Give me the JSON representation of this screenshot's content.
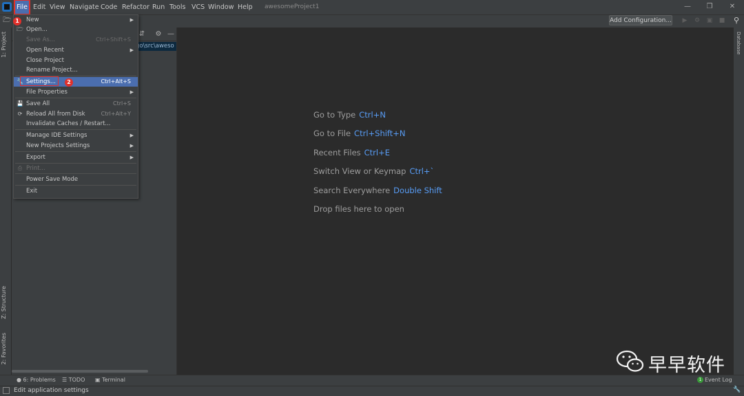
{
  "menubar": {
    "items": [
      "File",
      "Edit",
      "View",
      "Navigate",
      "Code",
      "Refactor",
      "Run",
      "Tools",
      "VCS",
      "Window",
      "Help"
    ],
    "project_title": "awesomeProject1"
  },
  "toolbar": {
    "add_configuration": "Add Configuration..."
  },
  "left_tabs": {
    "project": "1: Project",
    "structure": "Z: Structure",
    "favorites": "2: Favorites"
  },
  "right_tabs": {
    "database": "Database"
  },
  "project_panel": {
    "path_fragment": "go\\src\\aweso"
  },
  "file_menu": {
    "items": [
      {
        "label": "New",
        "shortcut": "",
        "submenu": true,
        "disabled": false
      },
      {
        "label": "Open...",
        "shortcut": "",
        "submenu": false,
        "disabled": false
      },
      {
        "label": "Save As...",
        "shortcut": "Ctrl+Shift+S",
        "submenu": false,
        "disabled": true
      },
      {
        "label": "Open Recent",
        "shortcut": "",
        "submenu": true,
        "disabled": false
      },
      {
        "label": "Close Project",
        "shortcut": "",
        "submenu": false,
        "disabled": false
      },
      {
        "label": "Rename Project...",
        "shortcut": "",
        "submenu": false,
        "disabled": false
      },
      {
        "label": "Settings...",
        "shortcut": "Ctrl+Alt+S",
        "submenu": false,
        "disabled": false,
        "selected": true
      },
      {
        "label": "File Properties",
        "shortcut": "",
        "submenu": true,
        "disabled": false
      },
      {
        "label": "Save All",
        "shortcut": "Ctrl+S",
        "submenu": false,
        "disabled": false
      },
      {
        "label": "Reload All from Disk",
        "shortcut": "Ctrl+Alt+Y",
        "submenu": false,
        "disabled": false
      },
      {
        "label": "Invalidate Caches / Restart...",
        "shortcut": "",
        "submenu": false,
        "disabled": false
      },
      {
        "label": "Manage IDE Settings",
        "shortcut": "",
        "submenu": true,
        "disabled": false
      },
      {
        "label": "New Projects Settings",
        "shortcut": "",
        "submenu": true,
        "disabled": false
      },
      {
        "label": "Export",
        "shortcut": "",
        "submenu": true,
        "disabled": false
      },
      {
        "label": "Print...",
        "shortcut": "",
        "submenu": false,
        "disabled": true
      },
      {
        "label": "Power Save Mode",
        "shortcut": "",
        "submenu": false,
        "disabled": false
      },
      {
        "label": "Exit",
        "shortcut": "",
        "submenu": false,
        "disabled": false
      }
    ]
  },
  "annotations": {
    "step1": "1",
    "step2": "2"
  },
  "editor_hints": [
    {
      "text": "Go to Type",
      "key": "Ctrl+N"
    },
    {
      "text": "Go to File",
      "key": "Ctrl+Shift+N"
    },
    {
      "text": "Recent Files",
      "key": "Ctrl+E"
    },
    {
      "text": "Switch View or Keymap",
      "key": "Ctrl+`"
    },
    {
      "text": "Search Everywhere",
      "key": "Double Shift"
    },
    {
      "text": "Drop files here to open",
      "key": ""
    }
  ],
  "bottom_tabs": {
    "problems": "6: Problems",
    "todo": "TODO",
    "terminal": "Terminal"
  },
  "event_log": {
    "label": "Event Log",
    "count": "1"
  },
  "status": {
    "text": "Edit application settings"
  },
  "watermark": {
    "text": "早早软件"
  },
  "colors": {
    "accent": "#4b6eaf",
    "highlight_red": "#e0302b",
    "link_blue": "#589df6"
  }
}
